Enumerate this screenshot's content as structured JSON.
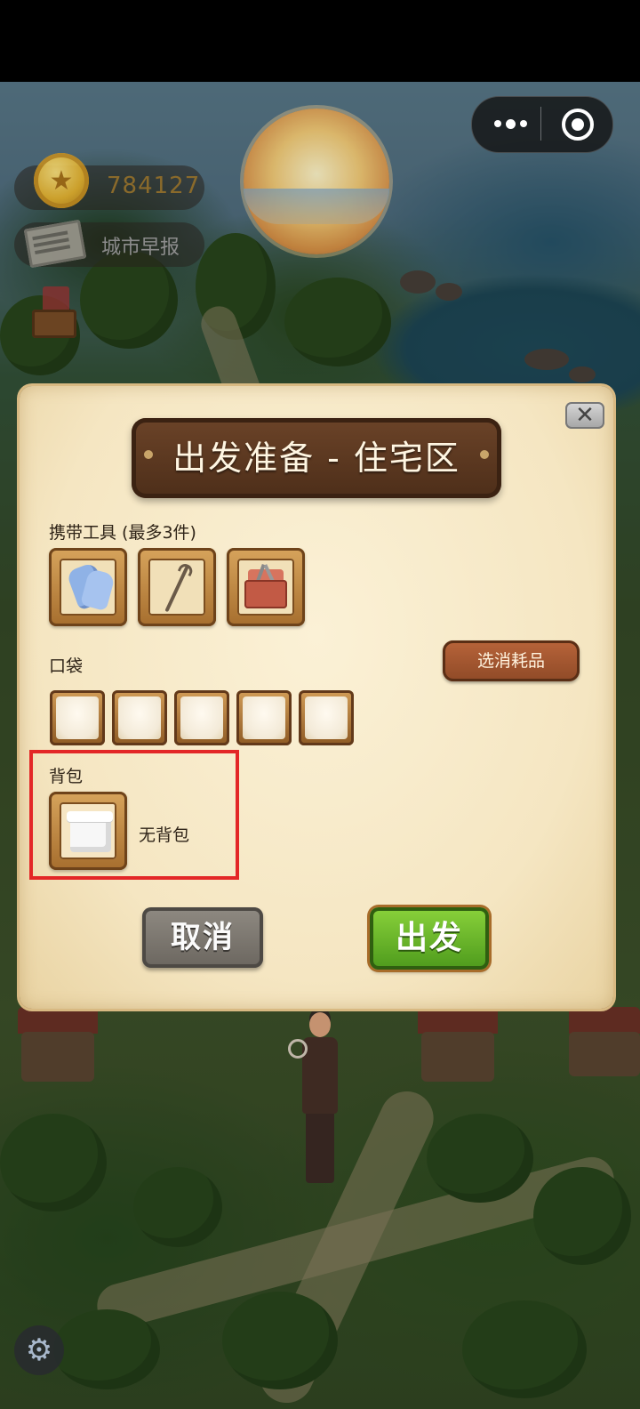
{
  "hud": {
    "coins": "784127",
    "newspaper_label": "城市早报"
  },
  "dialog": {
    "title": "出发准备 - 住宅区",
    "close_symbol": "✕",
    "tools": {
      "label": "携带工具 (最多3件)",
      "items": [
        {
          "icon": "gloves-icon"
        },
        {
          "icon": "hook-icon"
        },
        {
          "icon": "toolbox-icon"
        }
      ]
    },
    "pocket": {
      "label": "口袋",
      "select_button": "选消耗品",
      "slots": [
        "",
        "",
        "",
        "",
        ""
      ]
    },
    "backpack": {
      "label": "背包",
      "status": "无背包",
      "icon": "empty-box-icon"
    },
    "buttons": {
      "cancel": "取消",
      "go": "出发"
    }
  },
  "colors": {
    "highlight": "#e32727",
    "go_green": "#6cb52b",
    "panel_bg": "#f5e6c2",
    "wood": "#5a371f"
  }
}
